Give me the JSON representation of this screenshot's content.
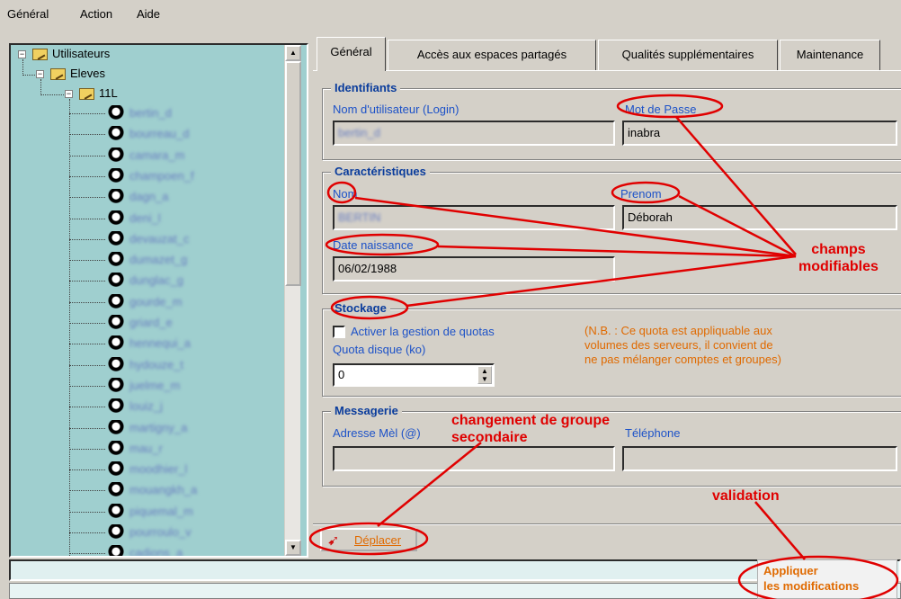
{
  "menu": [
    "Général",
    "Action",
    "Aide"
  ],
  "tree": {
    "root": "Utilisateurs",
    "group": "Eleves",
    "class": "11L",
    "users": [
      "bertin_d",
      "bourreau_d",
      "camara_m",
      "champoen_f",
      "dagn_a",
      "deni_l",
      "devauzat_c",
      "dumazet_g",
      "dunglac_g",
      "gourde_m",
      "griard_e",
      "hennequi_a",
      "hydouze_t",
      "juelme_m",
      "louiz_j",
      "martigny_a",
      "mau_r",
      "moodhier_l",
      "mouangkh_a",
      "piquemal_m",
      "pourroulo_v",
      "cadions_a"
    ]
  },
  "tabs": [
    "Général",
    "Accès aux espaces partagés",
    "Qualités supplémentaires",
    "Maintenance"
  ],
  "identifiants": {
    "title": "Identifiants",
    "login_label": "Nom d'utilisateur (Login)",
    "login_value": "bertin_d",
    "password_label": "Mot de Passe",
    "password_value": "inabra"
  },
  "caracteristiques": {
    "title": "Caractéristiques",
    "nom_label": "Nom",
    "nom_value": "BERTIN",
    "prenom_label": "Prenom",
    "prenom_value": "Déborah",
    "date_label": "Date naissance",
    "date_value": "06/02/1988"
  },
  "stockage": {
    "title": "Stockage",
    "quota_checkbox_label": "Activer la gestion de quotas",
    "quota_label": "Quota disque (ko)",
    "quota_value": "0",
    "note_lines": [
      "(N.B. : Ce quota est appliquable aux",
      "volumes des serveurs, il convient de",
      "ne pas mélanger comptes et groupes)"
    ]
  },
  "messagerie": {
    "title": "Messagerie",
    "email_label": "Adresse Mèl (@)",
    "phone_label": "Téléphone"
  },
  "buttons": {
    "move": "Déplacer",
    "apply_line1": "Appliquer",
    "apply_line2": "les modifications"
  },
  "annotations": {
    "editable_line1": "champs",
    "editable_line2": "modifiables",
    "group_change_line1": "changement de groupe",
    "group_change_line2": "secondaire",
    "validation": "validation"
  },
  "colors": {
    "tree_bg": "#9fcfcf",
    "label_blue": "#1d52c8",
    "group_title": "#0a3c9c",
    "note_orange": "#e06a00",
    "annotation_red": "#e00000"
  }
}
